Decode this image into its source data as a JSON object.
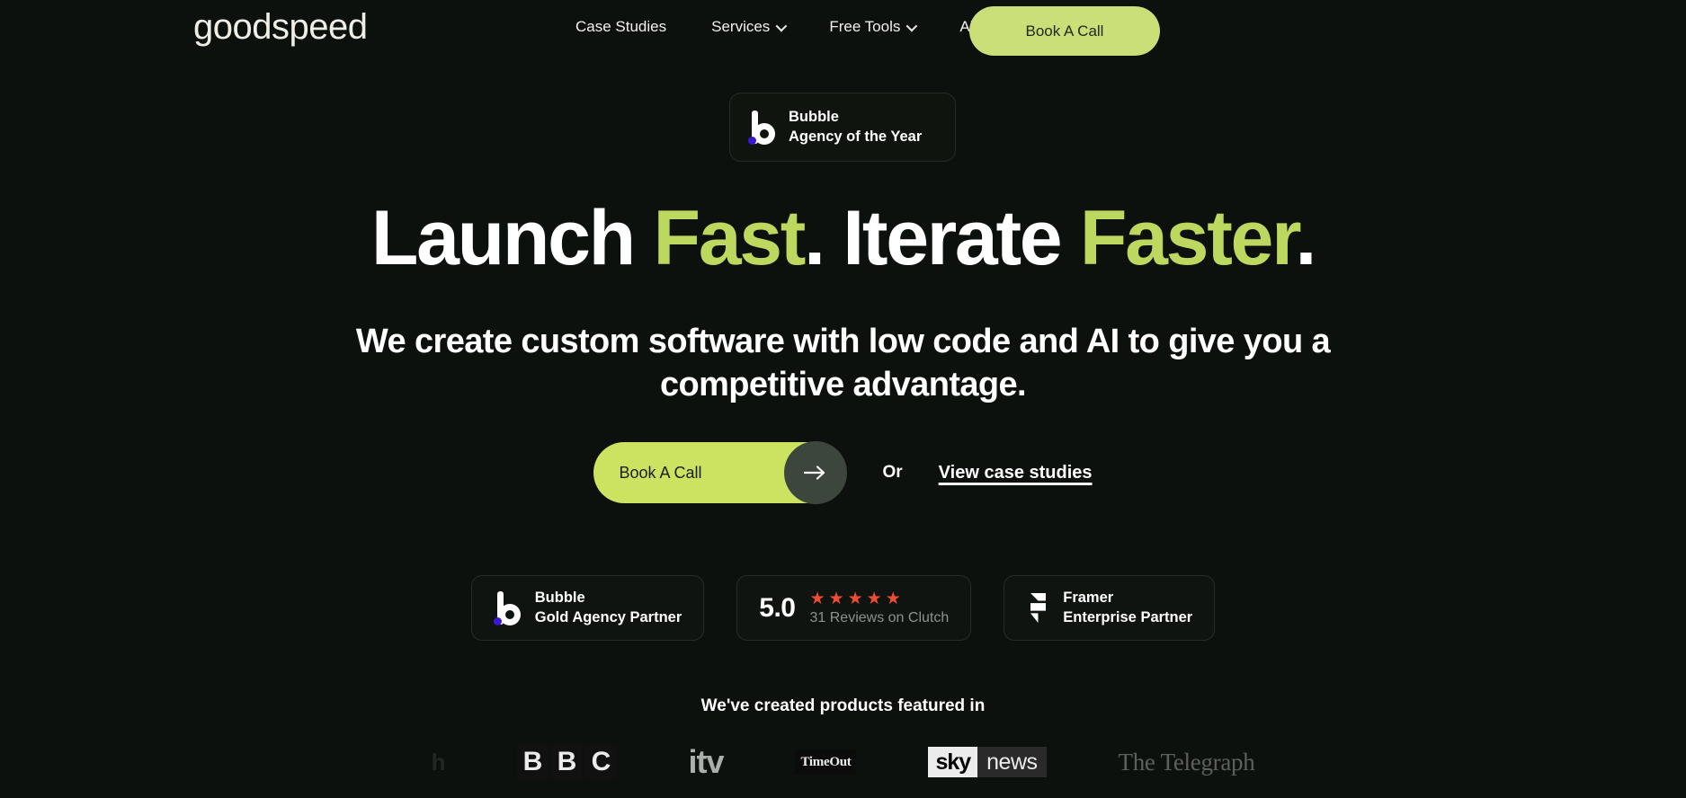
{
  "brand": {
    "name": "goodspeed"
  },
  "nav": {
    "links": [
      {
        "label": "Case Studies",
        "has_chevron": false,
        "icon": ""
      },
      {
        "label": "Services",
        "has_chevron": true,
        "icon": "chevron-down-icon"
      },
      {
        "label": "Free Tools",
        "has_chevron": true,
        "icon": "chevron-down-icon"
      },
      {
        "label": "About",
        "has_chevron": false,
        "icon": ""
      }
    ],
    "cta_label": "Book A Call",
    "cta_color": "#cbdf78"
  },
  "hero": {
    "award_badge": {
      "icon": "bubble-logo-icon",
      "line1": "Bubble",
      "line2": "Agency of the Year"
    },
    "headline": {
      "part1": "Launch ",
      "highlight1": "Fast",
      "part2": ". Iterate ",
      "highlight2": "Faster",
      "part3": ".",
      "highlight_color": "#bcd85e"
    },
    "subheadline": "We create custom software with low code and AI to give you a competitive advantage.",
    "cta": {
      "label": "Book A Call",
      "arrow_icon": "arrow-right-icon",
      "bg_color": "#cce361",
      "circle_color": "#3d463c"
    },
    "or_text": "Or",
    "secondary_link": "View case studies"
  },
  "trust": {
    "bubble": {
      "icon": "bubble-logo-icon",
      "line1": "Bubble",
      "line2": "Gold Agency Partner"
    },
    "clutch": {
      "score": "5.0",
      "stars": 5,
      "star_color": "#ee4c32",
      "reviews_text": "31 Reviews on Clutch"
    },
    "framer": {
      "icon": "framer-logo-icon",
      "line1": "Framer",
      "line2": "Enterprise Partner"
    }
  },
  "press": {
    "title": "We've created products featured in",
    "logos": [
      {
        "name": "partial-logo",
        "text": "h"
      },
      {
        "name": "bbc-logo",
        "letters": [
          "B",
          "B",
          "C"
        ]
      },
      {
        "name": "itv-logo",
        "text": "itv"
      },
      {
        "name": "timeout-logo",
        "text": "TimeOut"
      },
      {
        "name": "sky-news-logo",
        "text1": "sky",
        "text2": "news"
      },
      {
        "name": "telegraph-logo",
        "text": "The Telegraph"
      }
    ]
  }
}
